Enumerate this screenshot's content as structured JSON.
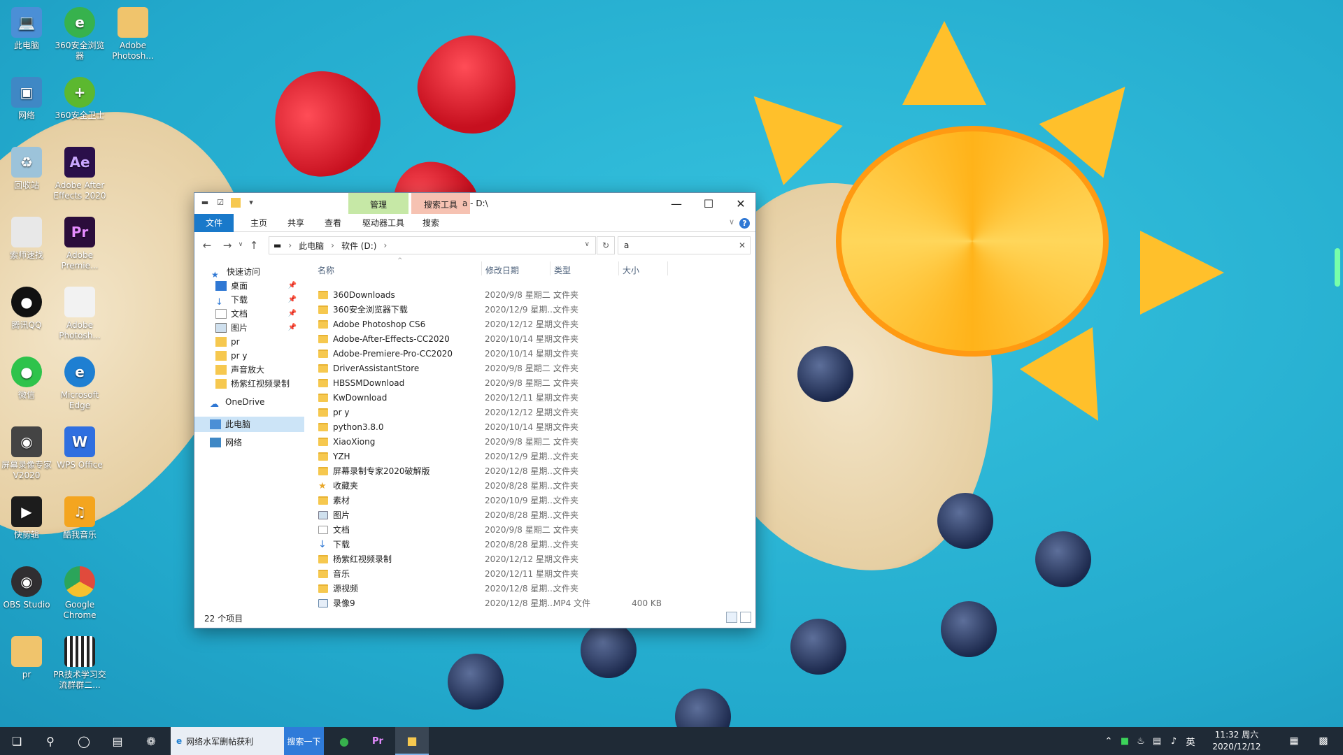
{
  "desktop_icons": [
    {
      "label": "此电脑",
      "color": "#4b8fd6"
    },
    {
      "label": "360安全浏览器",
      "color": "#37b24d"
    },
    {
      "label": "Adobe Photosh...",
      "color": "#f0c46c"
    },
    {
      "label": "网络",
      "color": "#3f88c5"
    },
    {
      "label": "360安全卫士",
      "color": "#5cb82f"
    },
    {
      "label": "回收站",
      "color": "#9cc3da"
    },
    {
      "label": "Adobe After Effects 2020",
      "color": "#2a0f4a"
    },
    {
      "label": "索师速找",
      "color": "#e8e8e8"
    },
    {
      "label": "Adobe Premie...",
      "color": "#2b0d3b"
    },
    {
      "label": "腾讯QQ",
      "color": "#111111"
    },
    {
      "label": "Adobe Photosh...",
      "color": "#f2f2f2"
    },
    {
      "label": "微信",
      "color": "#2ec34b"
    },
    {
      "label": "Microsoft Edge",
      "color": "#1e7fd2"
    },
    {
      "label": "屏幕录像专家 V2020",
      "color": "#444444"
    },
    {
      "label": "WPS Office",
      "color": "#2f6fe0"
    },
    {
      "label": "快剪辑",
      "color": "#1c1c1c"
    },
    {
      "label": "酷我音乐",
      "color": "#f4a51f"
    },
    {
      "label": "OBS Studio",
      "color": "#302e31"
    },
    {
      "label": "Google Chrome",
      "color": "#e04a3c"
    },
    {
      "label": "pr",
      "color": "#f0c46c"
    },
    {
      "label": "PR技术学习交流群群二...",
      "color": "#ffffff"
    }
  ],
  "window": {
    "ctx_manage": "管理",
    "ctx_search": "搜索工具",
    "title": "a - D:\\",
    "ribbon_tabs": [
      "文件",
      "主页",
      "共享",
      "查看",
      "驱动器工具",
      "搜索"
    ],
    "help": "?",
    "address": {
      "seg1": "此电脑",
      "seg2": "软件 (D:)"
    },
    "search_value": "a",
    "columns": {
      "name": "名称",
      "date": "修改日期",
      "type": "类型",
      "size": "大小"
    },
    "nav": {
      "quick_access": "快速访问",
      "desktop": "桌面",
      "downloads": "下载",
      "documents": "文档",
      "pictures": "图片",
      "pr": "pr",
      "pry": "pr y",
      "amplify": "声音放大",
      "yang": "杨紫红视频录制",
      "onedrive": "OneDrive",
      "this_pc": "此电脑",
      "network": "网络"
    },
    "files": [
      {
        "name": "360Downloads",
        "date": "2020/9/8 星期二 ...",
        "type": "文件夹",
        "size": ""
      },
      {
        "name": "360安全浏览器下载",
        "date": "2020/12/9 星期...",
        "type": "文件夹",
        "size": ""
      },
      {
        "name": "Adobe Photoshop CS6",
        "date": "2020/12/12 星期...",
        "type": "文件夹",
        "size": ""
      },
      {
        "name": "Adobe-After-Effects-CC2020",
        "date": "2020/10/14 星期...",
        "type": "文件夹",
        "size": ""
      },
      {
        "name": "Adobe-Premiere-Pro-CC2020",
        "date": "2020/10/14 星期...",
        "type": "文件夹",
        "size": ""
      },
      {
        "name": "DriverAssistantStore",
        "date": "2020/9/8 星期二 ...",
        "type": "文件夹",
        "size": ""
      },
      {
        "name": "HBSSMDownload",
        "date": "2020/9/8 星期二 ...",
        "type": "文件夹",
        "size": ""
      },
      {
        "name": "KwDownload",
        "date": "2020/12/11 星期...",
        "type": "文件夹",
        "size": ""
      },
      {
        "name": "pr y",
        "date": "2020/12/12 星期...",
        "type": "文件夹",
        "size": ""
      },
      {
        "name": "python3.8.0",
        "date": "2020/10/14 星期...",
        "type": "文件夹",
        "size": ""
      },
      {
        "name": "XiaoXiong",
        "date": "2020/9/8 星期二 ...",
        "type": "文件夹",
        "size": ""
      },
      {
        "name": "YZH",
        "date": "2020/12/9 星期...",
        "type": "文件夹",
        "size": ""
      },
      {
        "name": "屏幕录制专家2020破解版",
        "date": "2020/12/8 星期...",
        "type": "文件夹",
        "size": ""
      },
      {
        "name": "收藏夹",
        "date": "2020/8/28 星期...",
        "type": "文件夹",
        "size": ""
      },
      {
        "name": "素材",
        "date": "2020/10/9 星期...",
        "type": "文件夹",
        "size": ""
      },
      {
        "name": "图片",
        "date": "2020/8/28 星期...",
        "type": "文件夹",
        "size": ""
      },
      {
        "name": "文档",
        "date": "2020/9/8 星期二 ...",
        "type": "文件夹",
        "size": ""
      },
      {
        "name": "下载",
        "date": "2020/8/28 星期...",
        "type": "文件夹",
        "size": ""
      },
      {
        "name": "杨紫红视频录制",
        "date": "2020/12/12 星期...",
        "type": "文件夹",
        "size": ""
      },
      {
        "name": "音乐",
        "date": "2020/12/11 星期...",
        "type": "文件夹",
        "size": ""
      },
      {
        "name": "源视频",
        "date": "2020/12/8 星期...",
        "type": "文件夹",
        "size": ""
      },
      {
        "name": "录像9",
        "date": "2020/12/8 星期...",
        "type": "MP4 文件",
        "size": "400 KB"
      }
    ],
    "status_count": "22 个项目"
  },
  "taskbar": {
    "task1": "网络水军删帖获利",
    "task1_btn": "搜索一下",
    "clock_time": "11:32 周六",
    "clock_date": "2020/12/12",
    "ime": "英"
  }
}
